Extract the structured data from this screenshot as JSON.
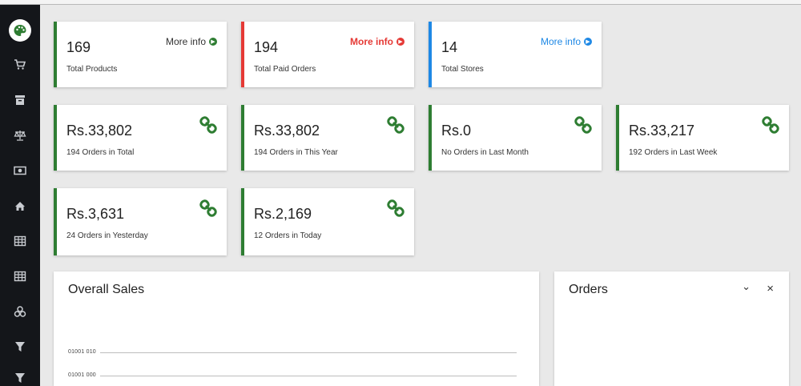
{
  "sidebar": {
    "items": [
      "cart-icon",
      "archive-icon",
      "balance-scale-icon",
      "money-icon",
      "home-icon",
      "table-icon",
      "grid-icon",
      "cubes-icon",
      "filter-icon",
      "funnel-icon"
    ]
  },
  "stats_row1": [
    {
      "value": "169",
      "label": "Total Products",
      "more": "More info",
      "accent": "#2e7d32"
    },
    {
      "value": "194",
      "label": "Total Paid Orders",
      "more": "More info",
      "accent": "#e53935"
    },
    {
      "value": "14",
      "label": "Total Stores",
      "more": "More info",
      "accent": "#1e88e5"
    }
  ],
  "stats_row2": [
    {
      "value": "Rs.33,802",
      "label": "194 Orders in Total"
    },
    {
      "value": "Rs.33,802",
      "label": "194 Orders in This Year"
    },
    {
      "value": "Rs.0",
      "label": "No Orders in Last Month"
    },
    {
      "value": "Rs.33,217",
      "label": "192 Orders in Last Week"
    }
  ],
  "stats_row3": [
    {
      "value": "Rs.3,631",
      "label": "24 Orders in Yesterday"
    },
    {
      "value": "Rs.2,169",
      "label": "12 Orders in Today"
    }
  ],
  "sales_panel": {
    "title": "Overall Sales",
    "ticks": [
      "01001 010",
      "01001 000"
    ]
  },
  "orders_panel": {
    "title": "Orders",
    "collapse": "⌄",
    "close": "×"
  },
  "colors": {
    "green": "#2e7d32",
    "red": "#e53935",
    "blue": "#1e88e5",
    "sidebar": "#14161a"
  }
}
